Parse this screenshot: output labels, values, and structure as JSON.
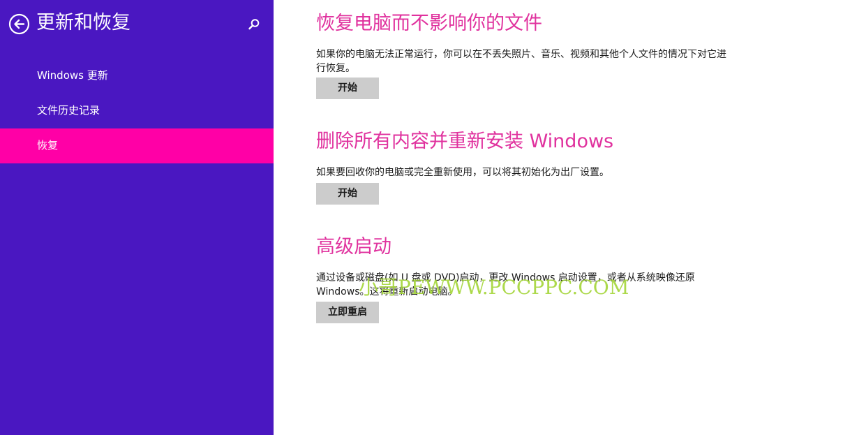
{
  "sidebar": {
    "title": "更新和恢复",
    "back_icon": "back-arrow-circle-icon",
    "search_icon": "search-icon",
    "items": [
      {
        "label": "Windows 更新",
        "selected": false
      },
      {
        "label": "文件历史记录",
        "selected": false
      },
      {
        "label": "恢复",
        "selected": true
      }
    ]
  },
  "main": {
    "sections": [
      {
        "title": "恢复电脑而不影响你的文件",
        "description": "如果你的电脑无法正常运行，你可以在不丢失照片、音乐、视频和其他个人文件的情况下对它进行恢复。",
        "button_label": "开始"
      },
      {
        "title": "删除所有内容并重新安装 Windows",
        "description": "如果要回收你的电脑或完全重新使用，可以将其初始化为出厂设置。",
        "button_label": "开始"
      },
      {
        "title": "高级启动",
        "description": "通过设备或磁盘(如 U 盘或 DVD)启动，更改 Windows 启动设置，或者从系统映像还原 Windows。这将重新启动电脑。",
        "button_label": "立即重启"
      }
    ]
  },
  "watermark": {
    "text": "小哥PEWWW.PCCPPC.COM"
  },
  "colors": {
    "sidebar_bg": "#4a17c1",
    "selected_bg": "#ff00a6",
    "heading": "#e0329e",
    "button_bg": "#cccccc",
    "watermark": "#a6d63c"
  }
}
